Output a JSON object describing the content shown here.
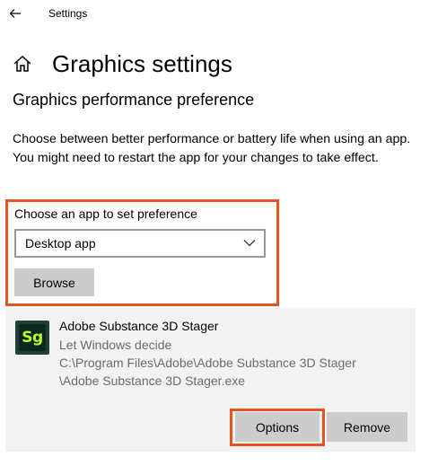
{
  "window": {
    "app_title": "Settings"
  },
  "header": {
    "title": "Graphics settings"
  },
  "section": {
    "title": "Graphics performance preference",
    "description": "Choose between better performance or battery life when using an app. You might need to restart the app for your changes to take effect."
  },
  "chooser": {
    "label": "Choose an app to set preference",
    "selected": "Desktop app",
    "browse_label": "Browse"
  },
  "app_entry": {
    "icon_text": "Sg",
    "name": "Adobe Substance 3D Stager",
    "preference": "Let Windows decide",
    "path_line1": "C:\\Program Files\\Adobe\\Adobe Substance 3D Stager",
    "path_line2": "\\Adobe Substance 3D Stager.exe",
    "options_label": "Options",
    "remove_label": "Remove"
  },
  "colors": {
    "highlight": "#e3541f",
    "button_bg": "#cccccc",
    "card_bg": "#f2f2f2",
    "secondary_text": "#6b6b6b",
    "app_icon_accent": "#b7ff2a"
  },
  "icons": {
    "back": "back-arrow-icon",
    "home": "home-icon",
    "dropdown": "chevron-down-icon",
    "app": "substance-stager-icon"
  }
}
